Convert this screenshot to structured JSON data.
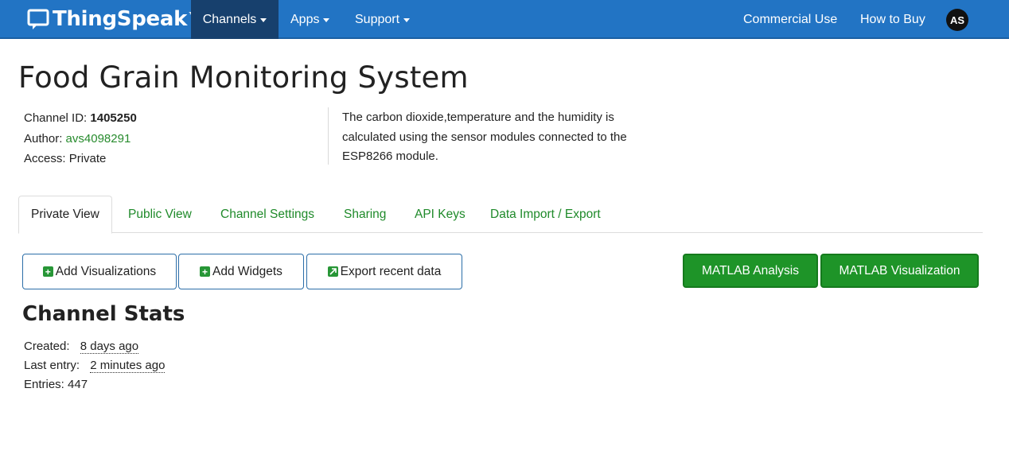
{
  "navbar": {
    "brand": "ThingSpeak",
    "brand_tm": "™",
    "items": [
      {
        "label": "Channels"
      },
      {
        "label": "Apps"
      },
      {
        "label": "Support"
      }
    ],
    "right_links": [
      {
        "label": "Commercial Use"
      },
      {
        "label": "How to Buy"
      }
    ],
    "avatar_initials": "AS",
    "colors": {
      "bar": "#2274c4",
      "active": "#17406d"
    }
  },
  "channel": {
    "title": "Food Grain Monitoring System",
    "id_label": "Channel ID:",
    "id_value": "1405250",
    "author_label": "Author:",
    "author_value": "avs4098291",
    "access_label": "Access:",
    "access_value": "Private",
    "description": "The carbon dioxide,temperature and the humidity is calculated using the sensor modules connected to the ESP8266 module."
  },
  "tabs": [
    {
      "label": "Private View",
      "active": true
    },
    {
      "label": "Public View"
    },
    {
      "label": "Channel Settings"
    },
    {
      "label": "Sharing"
    },
    {
      "label": "API Keys"
    },
    {
      "label": "Data Import / Export"
    }
  ],
  "actions": {
    "add_visualizations": "Add Visualizations",
    "add_widgets": "Add Widgets",
    "export_recent": "Export recent data",
    "matlab_analysis": "MATLAB Analysis",
    "matlab_visualization": "MATLAB Visualization"
  },
  "stats": {
    "title": "Channel Stats",
    "created_label": "Created:",
    "created_value": "8 days ago",
    "last_entry_label": "Last entry:",
    "last_entry_value": "2 minutes ago",
    "entries_label": "Entries:",
    "entries_value": "447"
  },
  "colors": {
    "link_green": "#1f8a2a",
    "button_green": "#1e9428",
    "button_border_blue": "#2c6ea8"
  }
}
